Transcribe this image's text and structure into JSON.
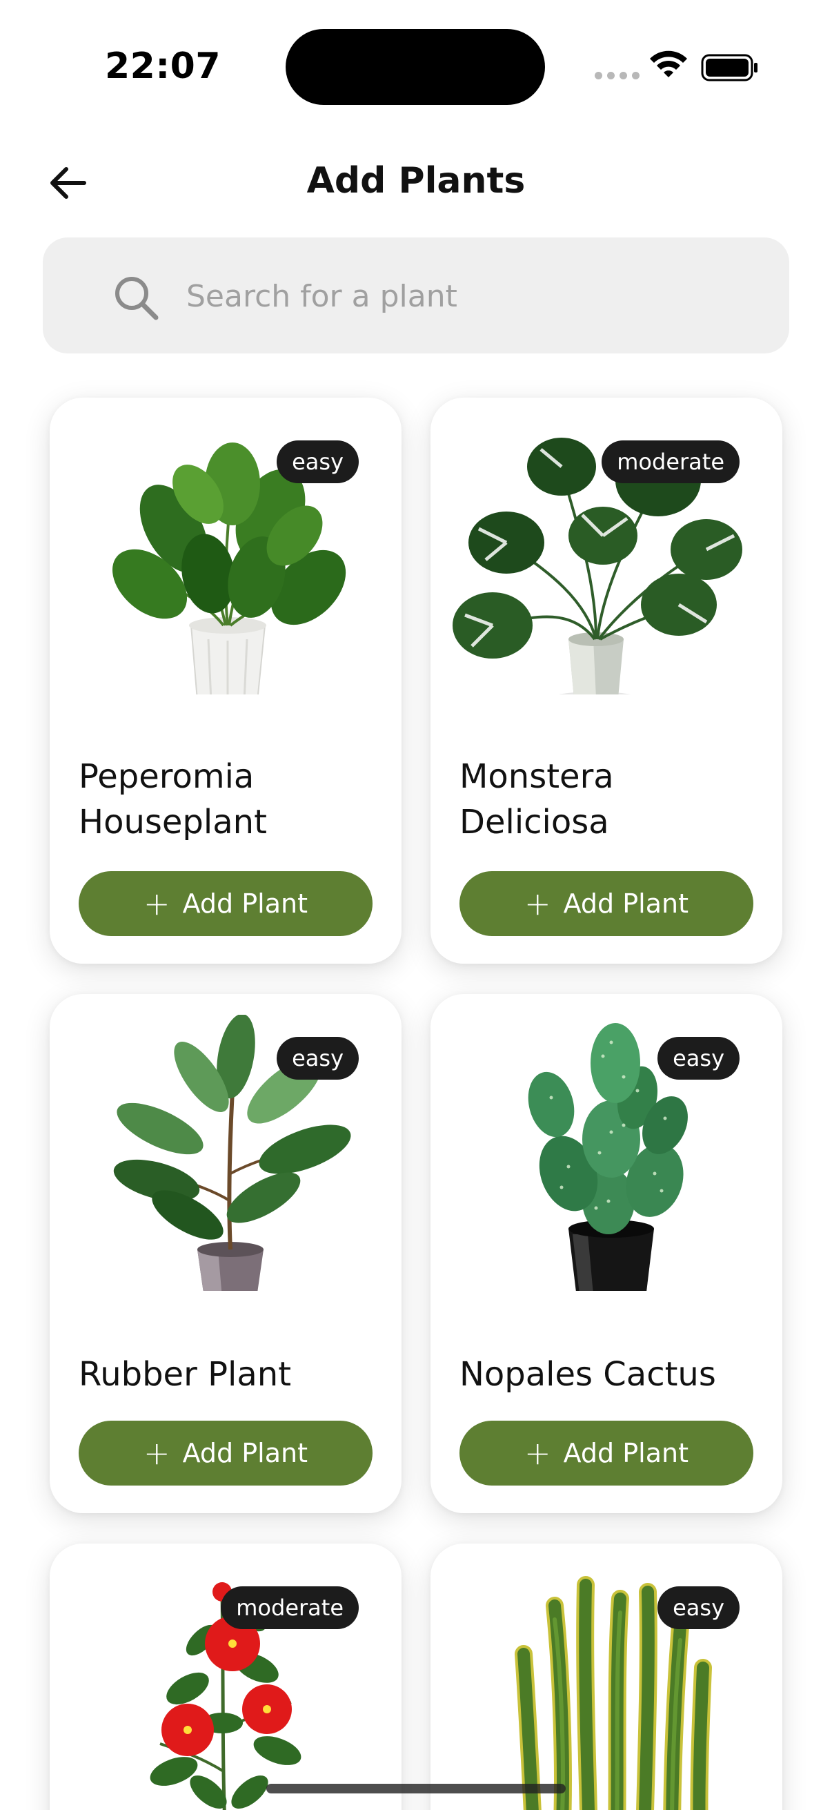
{
  "status_bar": {
    "time": "22:07"
  },
  "header": {
    "title": "Add Plants"
  },
  "search": {
    "placeholder": "Search for a plant",
    "value": ""
  },
  "colors": {
    "accent": "#5e7f32",
    "badge": "#1c1c1c",
    "search_bg": "#efefef"
  },
  "plants": [
    {
      "name": "Peperomia Houseplant",
      "difficulty": "easy",
      "button_label": "Add Plant"
    },
    {
      "name": "Monstera Deliciosa",
      "difficulty": "moderate",
      "button_label": "Add Plant"
    },
    {
      "name": "Rubber Plant",
      "difficulty": "easy",
      "button_label": "Add Plant"
    },
    {
      "name": "Nopales Cactus",
      "difficulty": "easy",
      "button_label": "Add Plant"
    },
    {
      "name": "",
      "difficulty": "moderate",
      "button_label": ""
    },
    {
      "name": "",
      "difficulty": "easy",
      "button_label": ""
    }
  ]
}
